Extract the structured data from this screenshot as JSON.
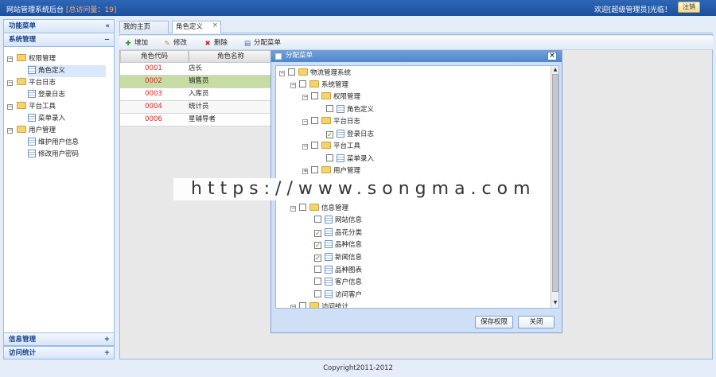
{
  "header": {
    "app_title": "网站管理系统后台",
    "visit_text": "[总访问量：19]",
    "welcome": "欢迎[超级管理员]光临！",
    "logout_label": "注销"
  },
  "sidebar": {
    "title": "功能菜单",
    "collapse_glyph": "«",
    "section_open": {
      "label": "系统管理",
      "toggle": "−"
    },
    "tree": [
      {
        "label": "权限管理",
        "type": "folder",
        "toggle": "−"
      },
      {
        "label": "角色定义",
        "type": "page",
        "selected": true
      },
      {
        "label": "平台日志",
        "type": "folder",
        "toggle": "−"
      },
      {
        "label": "登录日志",
        "type": "page"
      },
      {
        "label": "平台工具",
        "type": "folder",
        "toggle": "−"
      },
      {
        "label": "菜单录入",
        "type": "page"
      },
      {
        "label": "用户管理",
        "type": "folder",
        "toggle": "−"
      },
      {
        "label": "维护用户信息",
        "type": "page"
      },
      {
        "label": "修改用户密码",
        "type": "page"
      }
    ],
    "bottom_sections": [
      {
        "label": "信息管理",
        "toggle": "+"
      },
      {
        "label": "访问统计",
        "toggle": "+"
      }
    ]
  },
  "tabs": [
    {
      "label": "我的主页"
    },
    {
      "label": "角色定义",
      "close": "×"
    }
  ],
  "toolbar": {
    "add": "增加",
    "edit": "修改",
    "delete": "删除",
    "assign": "分配菜单"
  },
  "grid": {
    "columns": [
      "角色代码",
      "角色名称"
    ],
    "rows": [
      {
        "code": "0001",
        "name": "店长"
      },
      {
        "code": "0002",
        "name": "销售员"
      },
      {
        "code": "0003",
        "name": "入库员"
      },
      {
        "code": "0004",
        "name": "统计员"
      },
      {
        "code": "0006",
        "name": "星辅导者"
      }
    ]
  },
  "dialog": {
    "title": "分配菜单",
    "close": "×",
    "tree": [
      {
        "label": "物流管理系统",
        "type": "folder",
        "checked": false,
        "toggle": "−"
      },
      {
        "label": "系统管理",
        "type": "folder",
        "checked": false,
        "toggle": "−"
      },
      {
        "label": "权限管理",
        "type": "folder",
        "checked": false,
        "toggle": "−"
      },
      {
        "label": "角色定义",
        "type": "page",
        "checked": false
      },
      {
        "label": "平台日志",
        "type": "folder",
        "checked": false,
        "toggle": "−"
      },
      {
        "label": "登录日志",
        "type": "page",
        "checked": true
      },
      {
        "label": "平台工具",
        "type": "folder",
        "checked": false,
        "toggle": "−"
      },
      {
        "label": "菜单录入",
        "type": "page",
        "checked": false
      },
      {
        "label": "用户管理",
        "type": "folder",
        "checked": false,
        "toggle": "+"
      },
      {
        "label": "信息管理",
        "type": "folder",
        "checked": false,
        "toggle": "−"
      },
      {
        "label": "网站信息",
        "type": "page",
        "checked": false
      },
      {
        "label": "品花分类",
        "type": "page",
        "checked": true
      },
      {
        "label": "品种信息",
        "type": "page",
        "checked": true
      },
      {
        "label": "新闻信息",
        "type": "page",
        "checked": true
      },
      {
        "label": "品种图表",
        "type": "page",
        "checked": false
      },
      {
        "label": "客户信息",
        "type": "page",
        "checked": false
      },
      {
        "label": "访问客户",
        "type": "page",
        "checked": false
      },
      {
        "label": "访问统计",
        "type": "folder",
        "checked": false,
        "toggle": "−"
      }
    ],
    "save_label": "保存权限",
    "close_label": "关闭"
  },
  "watermark": "https://www.songma.com",
  "footer": "Copyright2011-2012",
  "colors": {
    "header_bg": "#1d4f9c",
    "highlight_row": "#c6dca4",
    "code_text": "#e02020"
  }
}
